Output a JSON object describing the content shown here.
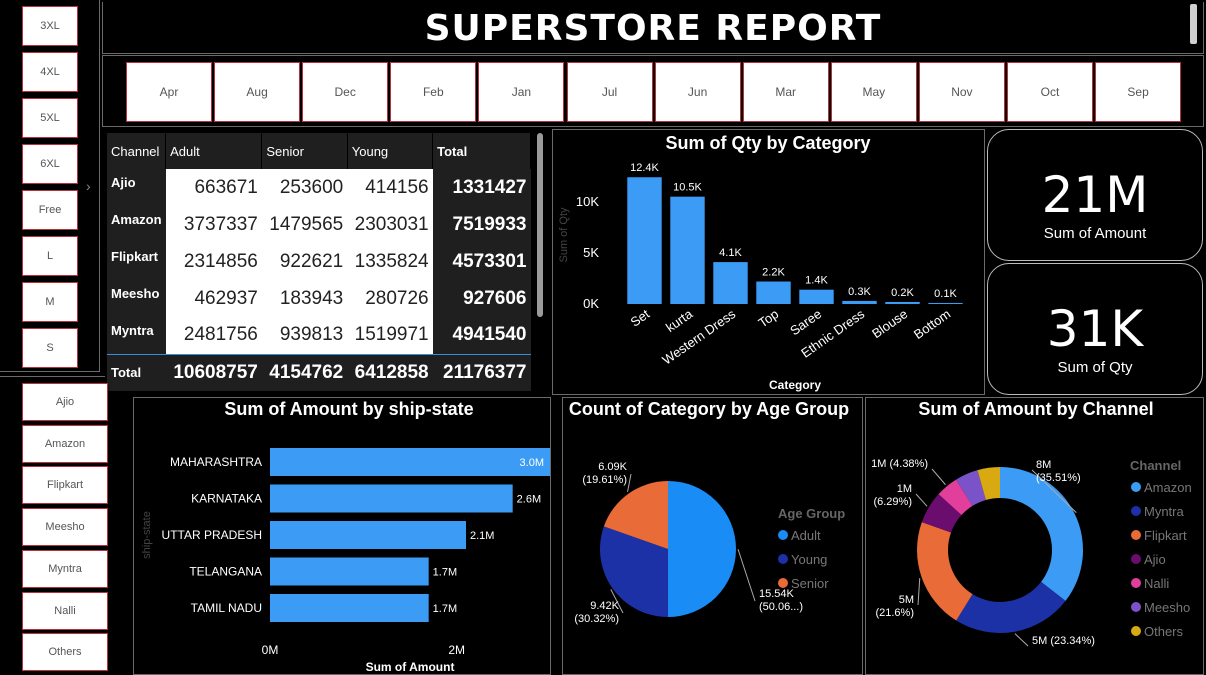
{
  "report": {
    "title": "SUPERSTORE REPORT"
  },
  "size_slicer": [
    "3XL",
    "4XL",
    "5XL",
    "6XL",
    "Free",
    "L",
    "M",
    "S"
  ],
  "channel_slicer": [
    "Ajio",
    "Amazon",
    "Flipkart",
    "Meesho",
    "Myntra",
    "Nalli",
    "Others"
  ],
  "month_slicer": [
    "Apr",
    "Aug",
    "Dec",
    "Feb",
    "Jan",
    "Jul",
    "Jun",
    "Mar",
    "May",
    "Nov",
    "Oct",
    "Sep"
  ],
  "matrix": {
    "headers": [
      "Channel",
      "Adult",
      "Senior",
      "Young",
      "Total"
    ],
    "rows": [
      {
        "channel": "Ajio",
        "adult": "663671",
        "senior": "253600",
        "young": "414156",
        "total": "1331427"
      },
      {
        "channel": "Amazon",
        "adult": "3737337",
        "senior": "1479565",
        "young": "2303031",
        "total": "7519933"
      },
      {
        "channel": "Flipkart",
        "adult": "2314856",
        "senior": "922621",
        "young": "1335824",
        "total": "4573301"
      },
      {
        "channel": "Meesho",
        "adult": "462937",
        "senior": "183943",
        "young": "280726",
        "total": "927606"
      },
      {
        "channel": "Myntra",
        "adult": "2481756",
        "senior": "939813",
        "young": "1519971",
        "total": "4941540"
      }
    ],
    "total_row": {
      "channel": "Total",
      "adult": "10608757",
      "senior": "4154762",
      "young": "6412858",
      "total": "21176377"
    }
  },
  "kpis": {
    "amount": {
      "value": "21M",
      "label": "Sum of Amount"
    },
    "qty": {
      "value": "31K",
      "label": "Sum of Qty"
    }
  },
  "colors": {
    "bar": "#3c9cf5",
    "adult": "#1a8cf5",
    "young": "#1c31a6",
    "senior": "#e96b37",
    "ajio": "#6a0d6e",
    "nalli": "#e23f9c",
    "meesho": "#7b53c8",
    "others": "#d8a911"
  },
  "chart_data": [
    {
      "type": "bar",
      "title": "Sum of Qty by Category",
      "xlabel": "Category",
      "ylabel": "Sum of Qty",
      "categories": [
        "Set",
        "kurta",
        "Western Dress",
        "Top",
        "Saree",
        "Ethnic Dress",
        "Blouse",
        "Bottom"
      ],
      "values": [
        12400,
        10500,
        4100,
        2200,
        1400,
        300,
        200,
        100
      ],
      "data_labels": [
        "12.4K",
        "10.5K",
        "4.1K",
        "2.2K",
        "1.4K",
        "0.3K",
        "0.2K",
        "0.1K"
      ],
      "yticks": [
        "0K",
        "5K",
        "10K"
      ],
      "ytick_values": [
        0,
        5000,
        10000
      ],
      "ylim": [
        0,
        13500
      ]
    },
    {
      "type": "bar",
      "orientation": "horizontal",
      "title": "Sum of Amount by ship-state",
      "xlabel": "Sum of Amount",
      "ylabel": "ship-state",
      "categories": [
        "MAHARASHTRA",
        "KARNATAKA",
        "UTTAR PRADESH",
        "TELANGANA",
        "TAMIL NADU"
      ],
      "values": [
        3000000,
        2600000,
        2100000,
        1700000,
        1700000
      ],
      "data_labels": [
        "3.0M",
        "2.6M",
        "2.1M",
        "1.7M",
        "1.7M"
      ],
      "xticks": [
        "0M",
        "2M"
      ],
      "xtick_values": [
        0,
        2000000
      ],
      "xlim": [
        0,
        3000000
      ]
    },
    {
      "type": "pie",
      "title": "Count of Category by Age Group",
      "legend_title": "Age Group",
      "legend": [
        "Adult",
        "Young",
        "Senior"
      ],
      "values": [
        15540,
        9420,
        6090
      ],
      "labels": [
        {
          "value": "15.54K",
          "pct": "(50.06...)"
        },
        {
          "value": "9.42K",
          "pct": "(30.32%)"
        },
        {
          "value": "6.09K",
          "pct": "(19.61%)"
        }
      ]
    },
    {
      "type": "pie",
      "donut": true,
      "title": "Sum of Amount by Channel",
      "legend_title": "Channel",
      "legend": [
        "Amazon",
        "Myntra",
        "Flipkart",
        "Ajio",
        "Nalli",
        "Meesho",
        "Others"
      ],
      "values": [
        35.51,
        23.34,
        21.6,
        6.29,
        4.38,
        4.5,
        4.38
      ],
      "labels": [
        {
          "value": "8M",
          "pct": "(35.51%)"
        },
        {
          "value": "5M",
          "pct": "(23.34%)"
        },
        {
          "value": "5M",
          "pct": "(21.6%)"
        },
        {
          "value": "1M",
          "pct": "(6.29%)"
        },
        {
          "value": "1M",
          "pct": "(4.38%)"
        }
      ]
    }
  ]
}
